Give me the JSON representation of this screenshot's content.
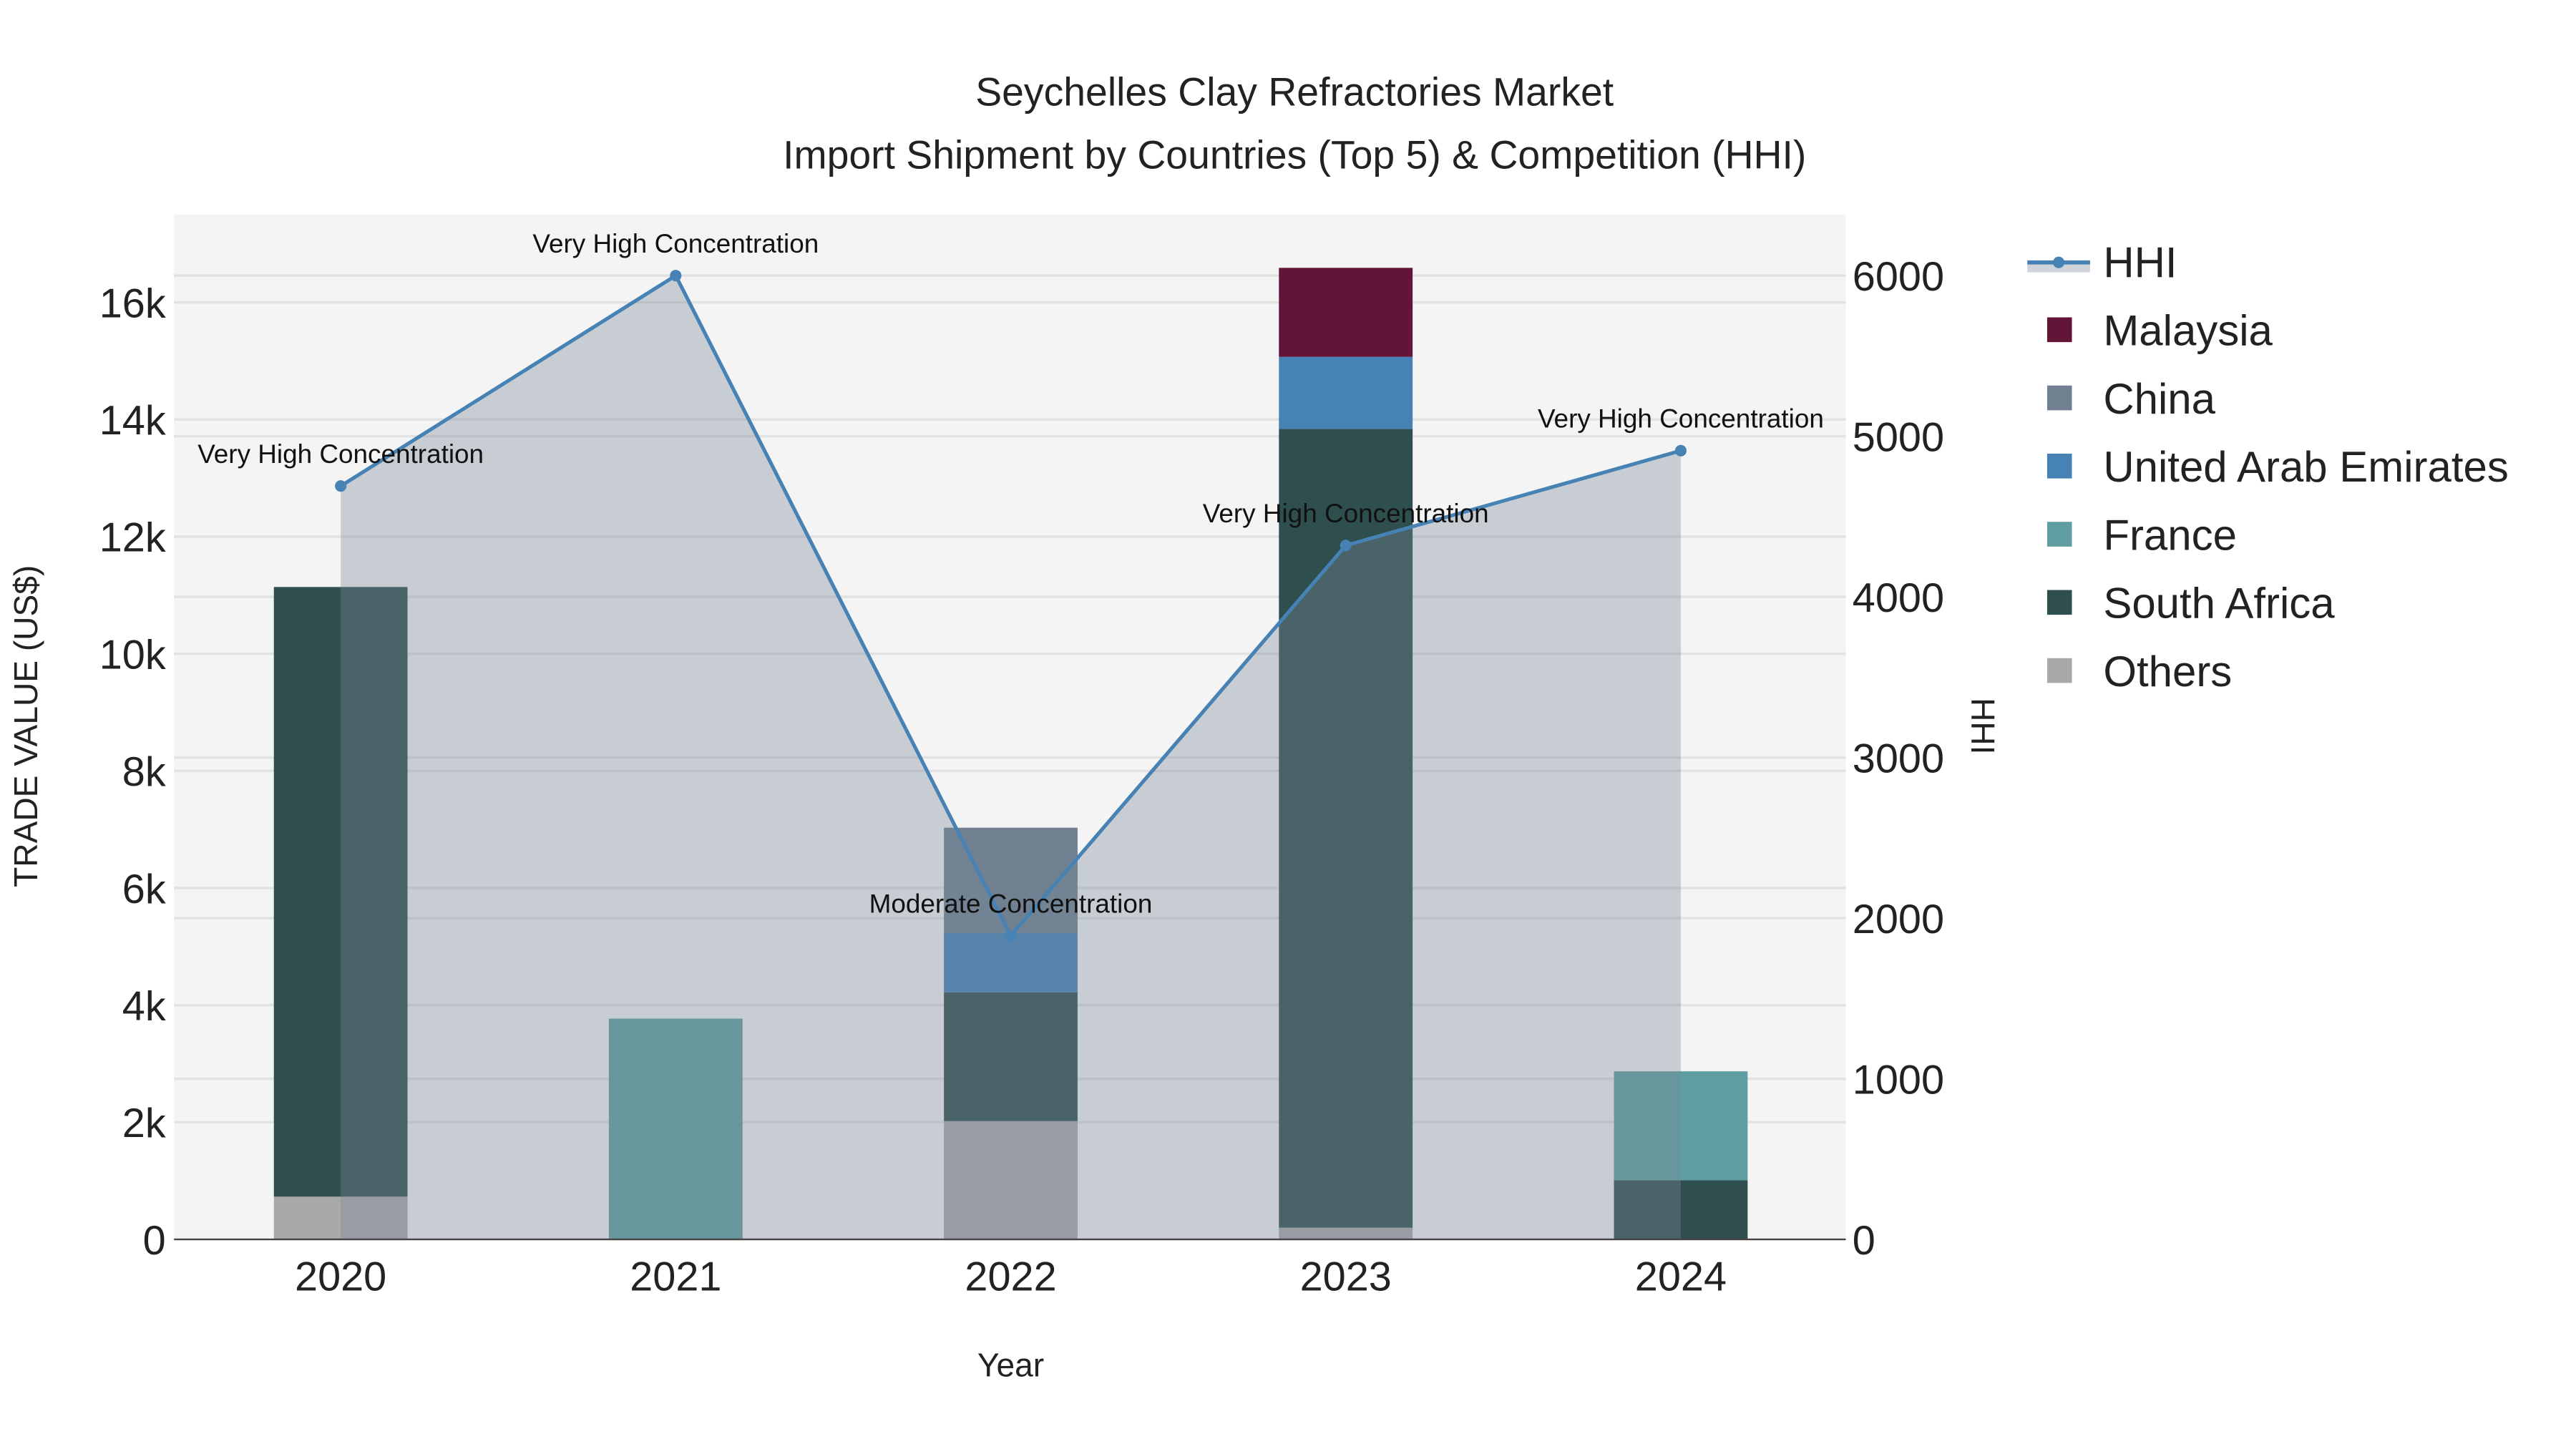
{
  "chart_data": {
    "type": "bar",
    "title_line1": "Seychelles Clay Refractories Market",
    "title_line2": "Import Shipment by Countries (Top 5) & Competition (HHI)",
    "xlabel": "Year",
    "ylabel": "TRADE VALUE (US$)",
    "y2label": "HHI",
    "categories": [
      "2020",
      "2021",
      "2022",
      "2023",
      "2024"
    ],
    "ylim": [
      0,
      17500
    ],
    "y2lim": [
      0,
      6380
    ],
    "yticks": [
      0,
      2000,
      4000,
      6000,
      8000,
      10000,
      12000,
      14000,
      16000
    ],
    "ytick_labels": [
      "0",
      "2k",
      "4k",
      "6k",
      "8k",
      "10k",
      "12k",
      "14k",
      "16k"
    ],
    "y2ticks": [
      0,
      1000,
      2000,
      3000,
      4000,
      5000,
      6000
    ],
    "y2tick_labels": [
      "0",
      "1000",
      "2000",
      "3000",
      "4000",
      "5000",
      "6000"
    ],
    "grid": true,
    "legend_position": "right",
    "series": [
      {
        "name": "Others",
        "color": "#a9a9a9",
        "values": [
          730,
          0,
          2020,
          200,
          0
        ]
      },
      {
        "name": "South Africa",
        "color": "#2f4f4f",
        "values": [
          10410,
          0,
          2200,
          13640,
          1010
        ]
      },
      {
        "name": "France",
        "color": "#5f9ea0",
        "values": [
          0,
          3770,
          0,
          0,
          1860
        ]
      },
      {
        "name": "United Arab Emirates",
        "color": "#4682b4",
        "values": [
          0,
          0,
          1010,
          1230,
          0
        ]
      },
      {
        "name": "China",
        "color": "#708090",
        "values": [
          0,
          0,
          1800,
          0,
          0
        ]
      },
      {
        "name": "Malaysia",
        "color": "#631537",
        "values": [
          0,
          0,
          0,
          1520,
          0
        ]
      }
    ],
    "hhi": {
      "name": "HHI",
      "color": "#4682b4",
      "values": [
        4690,
        6000,
        1890,
        4320,
        4910
      ],
      "annotations": [
        "Very High Concentration",
        "Very High Concentration",
        "Moderate Concentration",
        "Very High Concentration",
        "Very High Concentration"
      ]
    },
    "legend_order": [
      "HHI",
      "Malaysia",
      "China",
      "United Arab Emirates",
      "France",
      "South Africa",
      "Others"
    ]
  }
}
